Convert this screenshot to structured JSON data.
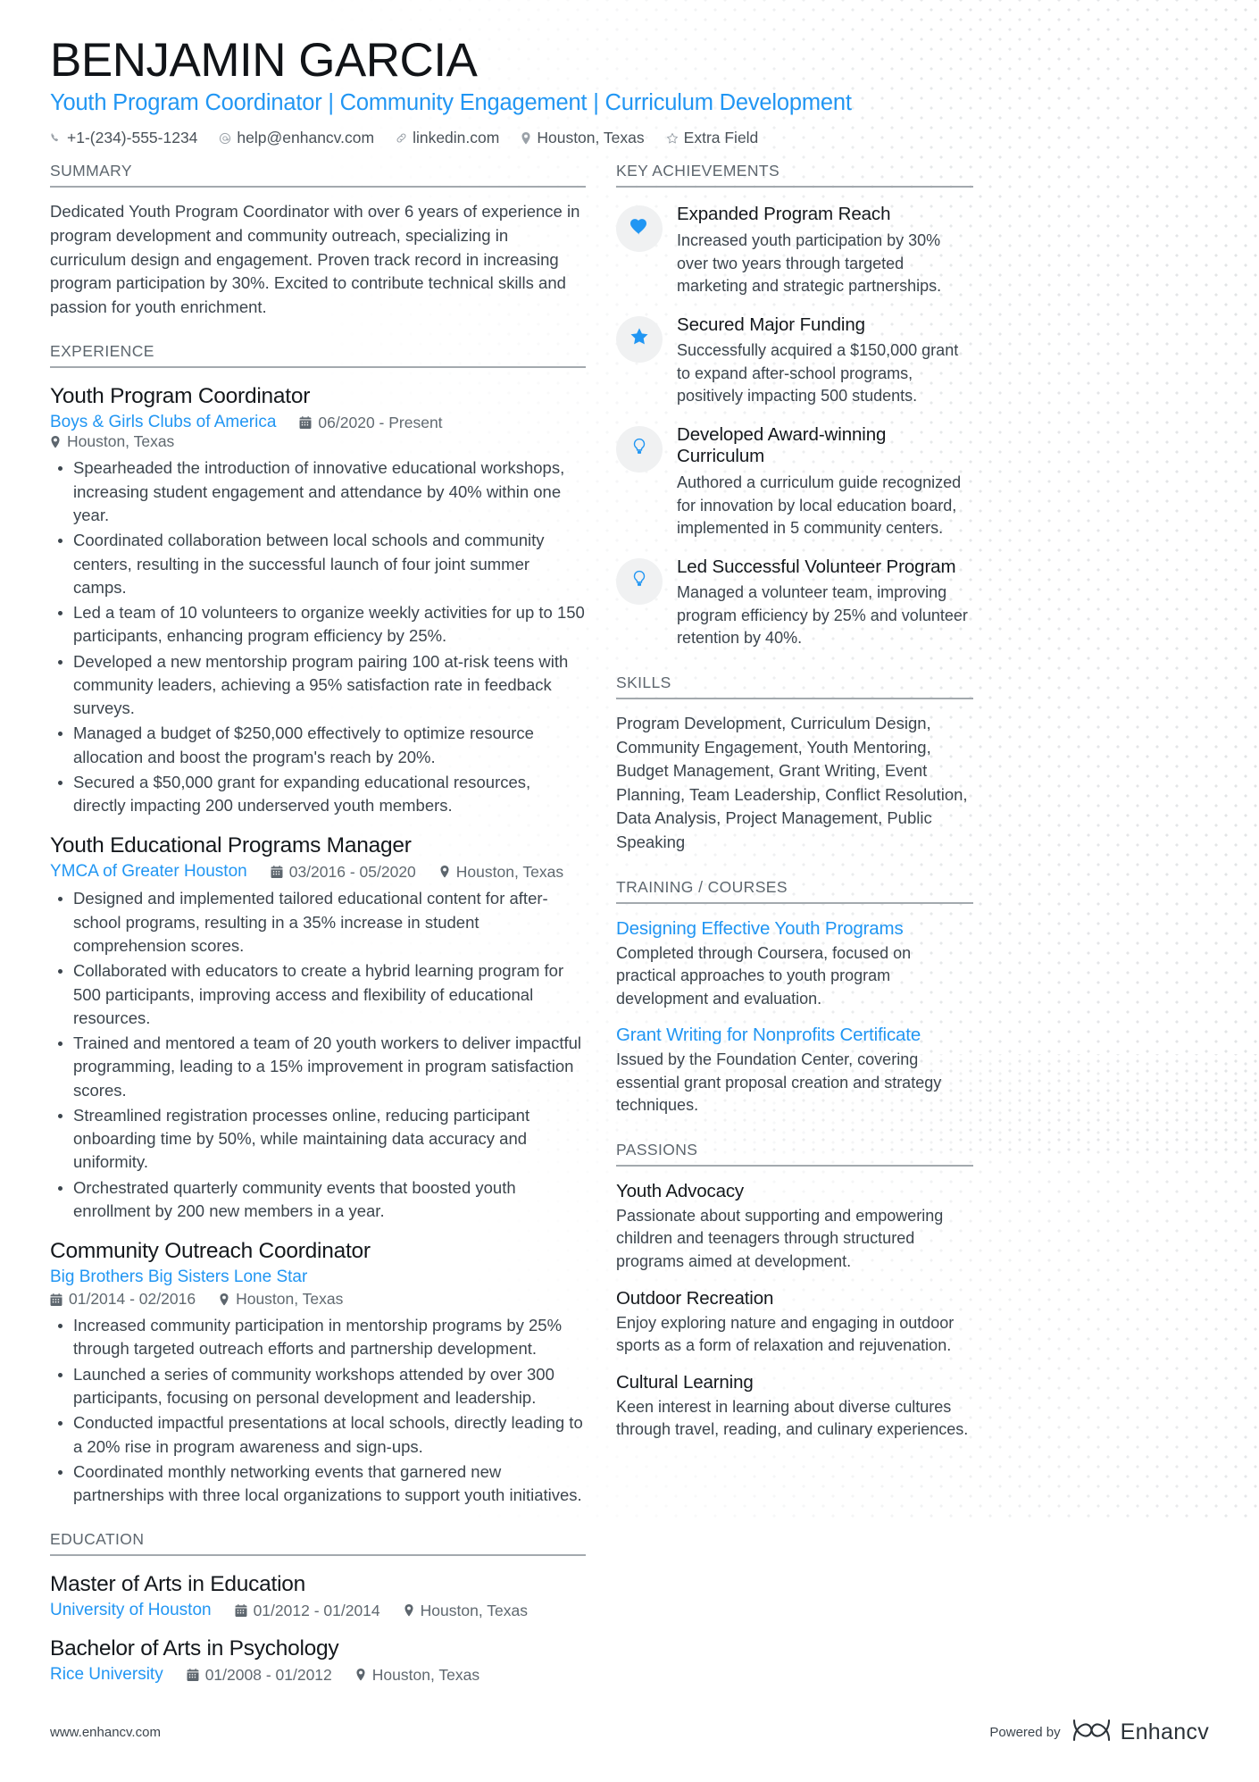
{
  "colors": {
    "accent": "#2196f3",
    "heading": "#14181c",
    "body": "#3c454d",
    "muted": "#5d666e"
  },
  "header": {
    "full_name": "BENJAMIN GARCIA",
    "headline": "Youth Program Coordinator | Community Engagement | Curriculum Development",
    "contacts": [
      {
        "icon": "phone-icon",
        "text": "+1-(234)-555-1234"
      },
      {
        "icon": "email-icon",
        "text": "help@enhancv.com"
      },
      {
        "icon": "link-icon",
        "text": "linkedin.com"
      },
      {
        "icon": "location-pin-icon",
        "text": "Houston, Texas"
      },
      {
        "icon": "star-outline-icon",
        "text": "Extra Field"
      }
    ]
  },
  "summary": {
    "title": "SUMMARY",
    "text": "Dedicated Youth Program Coordinator with over 6 years of experience in program development and community outreach, specializing in curriculum design and engagement. Proven track record in increasing program participation by 30%. Excited to contribute technical skills and passion for youth enrichment."
  },
  "experience": {
    "title": "EXPERIENCE",
    "entries": [
      {
        "role": "Youth Program Coordinator",
        "org": "Boys & Girls Clubs of America",
        "dates": "06/2020 - Present",
        "location": "Houston, Texas",
        "meta_layout": "inline",
        "bullets": [
          "Spearheaded the introduction of innovative educational workshops, increasing student engagement and attendance by 40% within one year.",
          "Coordinated collaboration between local schools and community centers, resulting in the successful launch of four joint summer camps.",
          "Led a team of 10 volunteers to organize weekly activities for up to 150 participants, enhancing program efficiency by 25%.",
          "Developed a new mentorship program pairing 100 at-risk teens with community leaders, achieving a 95% satisfaction rate in feedback surveys.",
          "Managed a budget of $250,000 effectively to optimize resource allocation and boost the program's reach by 20%.",
          "Secured a $50,000 grant for expanding educational resources, directly impacting 200 underserved youth members."
        ]
      },
      {
        "role": "Youth Educational Programs Manager",
        "org": "YMCA of Greater Houston",
        "dates": "03/2016 - 05/2020",
        "location": "Houston, Texas",
        "meta_layout": "inline",
        "bullets": [
          "Designed and implemented tailored educational content for after-school programs, resulting in a 35% increase in student comprehension scores.",
          "Collaborated with educators to create a hybrid learning program for 500 participants, improving access and flexibility of educational resources.",
          "Trained and mentored a team of 20 youth workers to deliver impactful programming, leading to a 15% improvement in program satisfaction scores.",
          "Streamlined registration processes online, reducing participant onboarding time by 50%, while maintaining data accuracy and uniformity.",
          "Orchestrated quarterly community events that boosted youth enrollment by 200 new members in a year."
        ]
      },
      {
        "role": "Community Outreach Coordinator",
        "org": "Big Brothers Big Sisters Lone Star",
        "dates": "01/2014 - 02/2016",
        "location": "Houston, Texas",
        "meta_layout": "stacked",
        "bullets": [
          "Increased community participation in mentorship programs by 25% through targeted outreach efforts and partnership development.",
          "Launched a series of community workshops attended by over 300 participants, focusing on personal development and leadership.",
          "Conducted impactful presentations at local schools, directly leading to a 20% rise in program awareness and sign-ups.",
          "Coordinated monthly networking events that garnered new partnerships with three local organizations to support youth initiatives."
        ]
      }
    ]
  },
  "education": {
    "title": "EDUCATION",
    "entries": [
      {
        "degree": "Master of Arts in Education",
        "school": "University of Houston",
        "dates": "01/2012 - 01/2014",
        "location": "Houston, Texas"
      },
      {
        "degree": "Bachelor of Arts in Psychology",
        "school": "Rice University",
        "dates": "01/2008 - 01/2012",
        "location": "Houston, Texas"
      }
    ]
  },
  "key_achievements": {
    "title": "KEY ACHIEVEMENTS",
    "items": [
      {
        "icon": "heart-icon",
        "title": "Expanded Program Reach",
        "description": "Increased youth participation by 30% over two years through targeted marketing and strategic partnerships."
      },
      {
        "icon": "star-icon",
        "title": "Secured Major Funding",
        "description": "Successfully acquired a $150,000 grant to expand after-school programs, positively impacting 500 students."
      },
      {
        "icon": "lightbulb-icon",
        "title": "Developed Award-winning Curriculum",
        "description": "Authored a curriculum guide recognized for innovation by local education board, implemented in 5 community centers."
      },
      {
        "icon": "lightbulb-icon",
        "title": "Led Successful Volunteer Program",
        "description": "Managed a volunteer team, improving program efficiency by 25% and volunteer retention by 40%."
      }
    ]
  },
  "skills": {
    "title": "SKILLS",
    "text": "Program Development, Curriculum Design, Community Engagement, Youth Mentoring, Budget Management, Grant Writing, Event Planning, Team Leadership, Conflict Resolution, Data Analysis, Project Management, Public Speaking"
  },
  "training": {
    "title": "TRAINING / COURSES",
    "items": [
      {
        "name": "Designing Effective Youth Programs",
        "description": "Completed through Coursera, focused on practical approaches to youth program development and evaluation."
      },
      {
        "name": "Grant Writing for Nonprofits Certificate",
        "description": "Issued by the Foundation Center, covering essential grant proposal creation and strategy techniques."
      }
    ]
  },
  "passions": {
    "title": "PASSIONS",
    "items": [
      {
        "name": "Youth Advocacy",
        "description": "Passionate about supporting and empowering children and teenagers through structured programs aimed at development."
      },
      {
        "name": "Outdoor Recreation",
        "description": "Enjoy exploring nature and engaging in outdoor sports as a form of relaxation and rejuvenation."
      },
      {
        "name": "Cultural Learning",
        "description": "Keen interest in learning about diverse cultures through travel, reading, and culinary experiences."
      }
    ]
  },
  "footer": {
    "url": "www.enhancv.com",
    "powered_by": "Powered by",
    "brand": "Enhancv"
  }
}
